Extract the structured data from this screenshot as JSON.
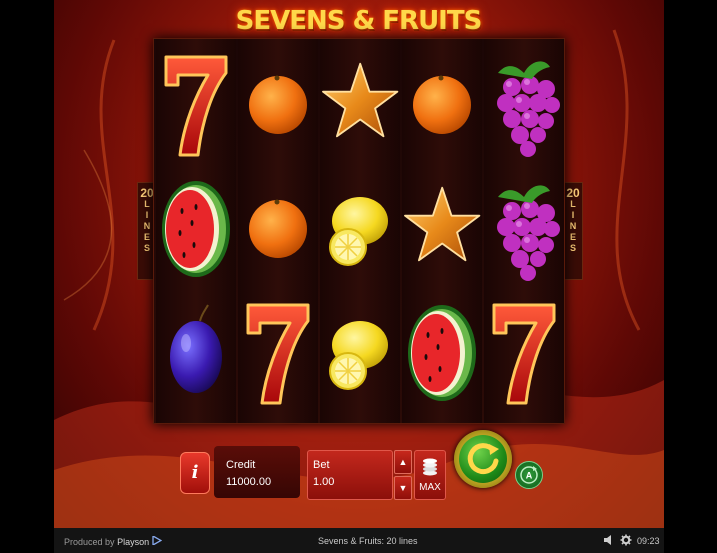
{
  "game": {
    "title": "SEVENS & FRUITS",
    "lines_count": "20",
    "lines_word": [
      "L",
      "I",
      "N",
      "E",
      "S"
    ]
  },
  "reels": [
    [
      "seven",
      "watermelon",
      "plum"
    ],
    [
      "orange",
      "orange",
      "seven"
    ],
    [
      "star",
      "lemon",
      "lemon"
    ],
    [
      "orange",
      "star",
      "watermelon"
    ],
    [
      "grapes",
      "grapes",
      "seven"
    ]
  ],
  "panel": {
    "info_label": "i",
    "credit_label": "Credit",
    "credit_value": "11000.00",
    "bet_label": "Bet",
    "bet_value": "1.00",
    "max_label": "MAX",
    "spin_icon": "refresh-arrow",
    "autoplay_label": "A"
  },
  "status_bar": {
    "produced_by": "Produced by",
    "provider": "Playson",
    "game_caption": "Sevens & Fruits: 20 lines",
    "time": "09:23"
  },
  "colors": {
    "title": "#ffd84a",
    "bet_button": "#c3281d",
    "spin_button": "#1e8a18",
    "spin_ring": "#d8c840"
  }
}
